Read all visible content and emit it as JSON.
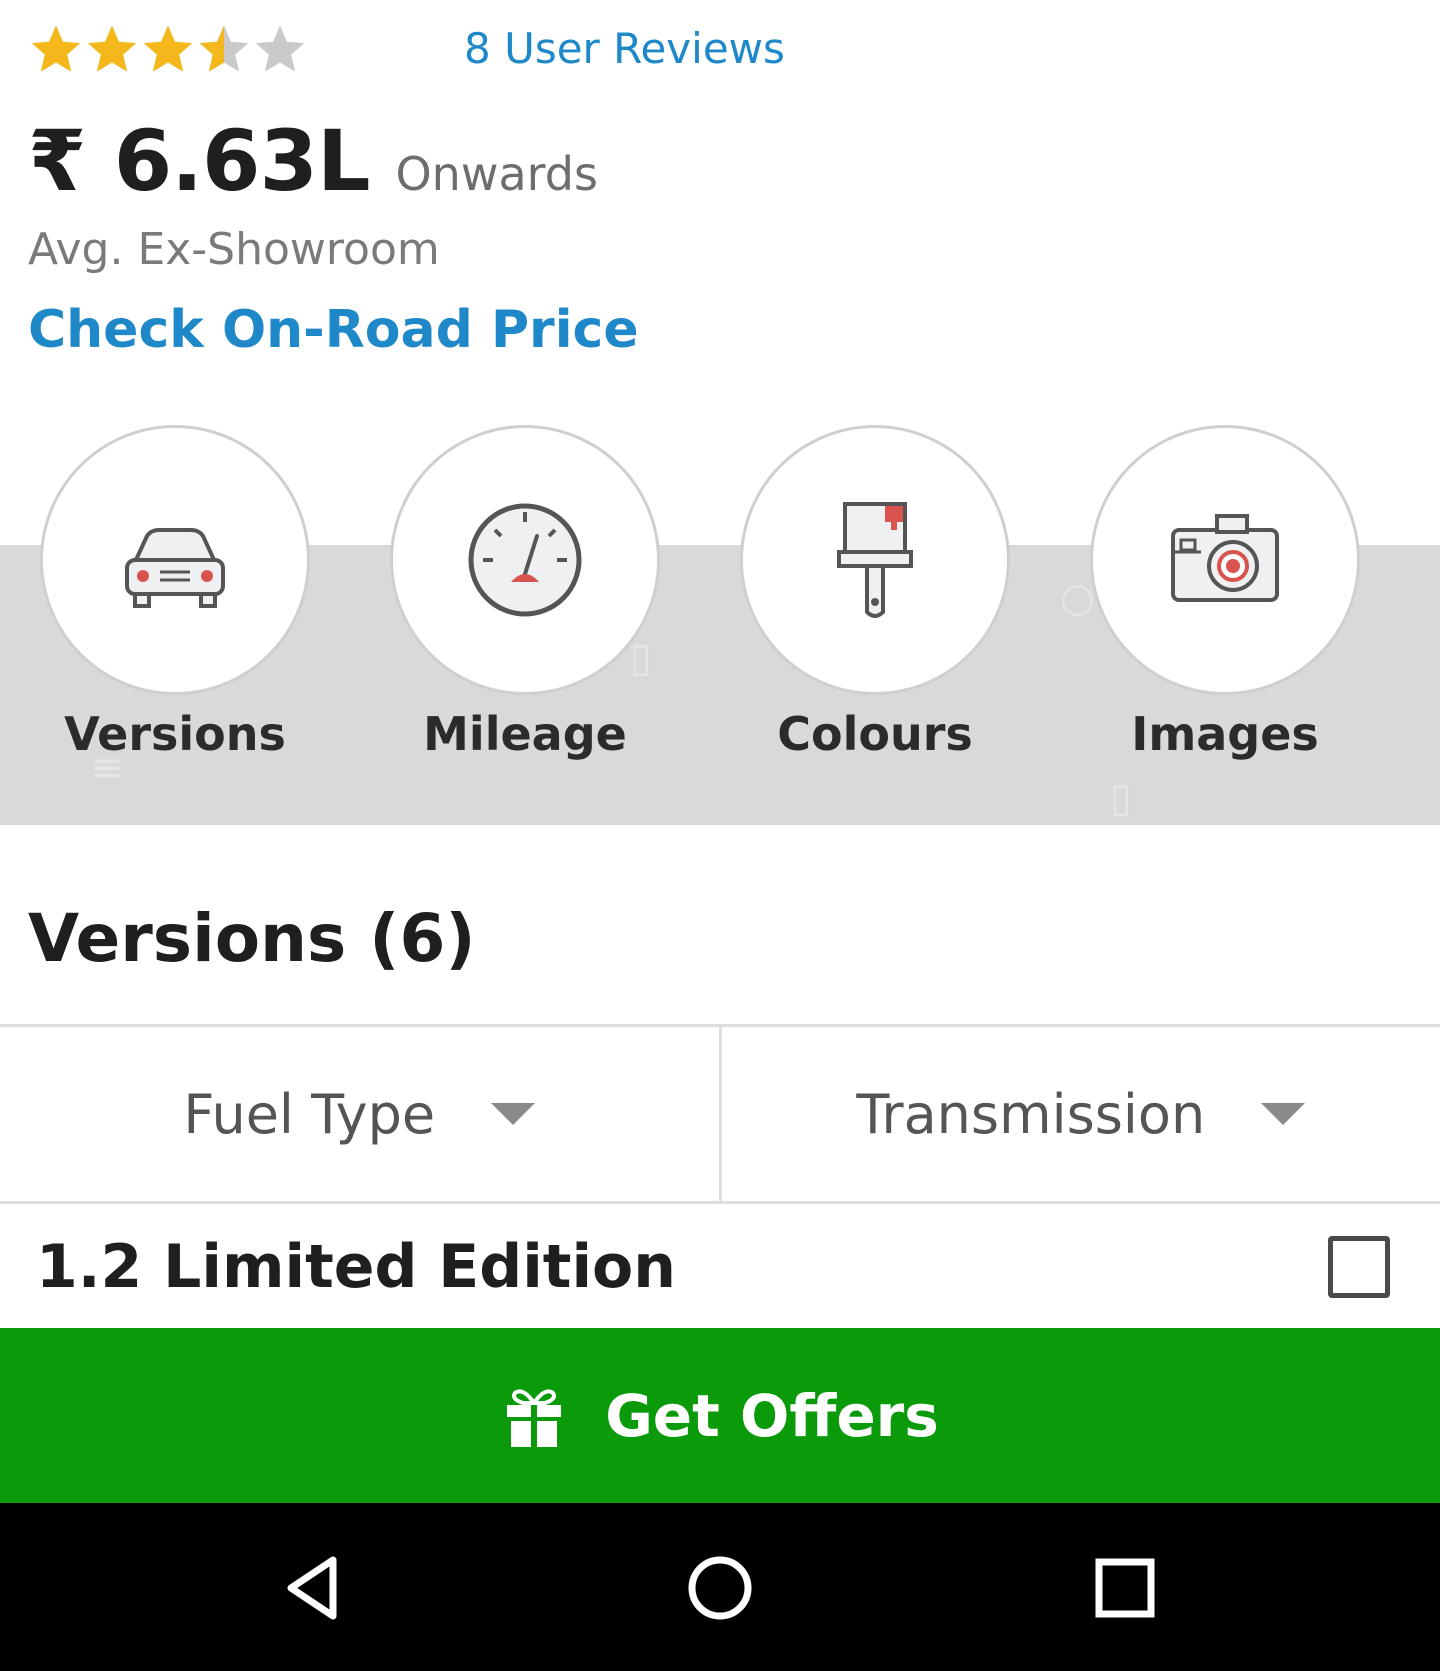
{
  "rating": {
    "stars": 3.5,
    "max": 5,
    "filled_color": "#f5b81c",
    "empty_color": "#c9c9c9",
    "reviews_label": "8 User Reviews"
  },
  "price": {
    "value": "₹ 6.63L",
    "suffix": "Onwards",
    "note": "Avg. Ex-Showroom",
    "onroad_label": "Check On-Road Price"
  },
  "quick_links": [
    {
      "label": "Versions",
      "icon": "car-icon"
    },
    {
      "label": "Mileage",
      "icon": "speedometer-icon"
    },
    {
      "label": "Colours",
      "icon": "paint-brush-icon"
    },
    {
      "label": "Images",
      "icon": "camera-icon"
    }
  ],
  "versions": {
    "title": "Versions (6)",
    "filters": [
      {
        "label": "Fuel Type",
        "icon": "caret-down-icon"
      },
      {
        "label": "Transmission",
        "icon": "caret-down-icon"
      }
    ],
    "items": [
      {
        "name": "1.2 Limited Edition",
        "checked": false
      }
    ]
  },
  "cta": {
    "label": "Get Offers",
    "icon": "gift-icon",
    "color": "#0a9a0a"
  },
  "navbar": {
    "buttons": [
      "back-icon",
      "home-icon",
      "recents-icon"
    ]
  },
  "colors": {
    "link": "#1e88c9",
    "band": "#d9d9d9"
  }
}
